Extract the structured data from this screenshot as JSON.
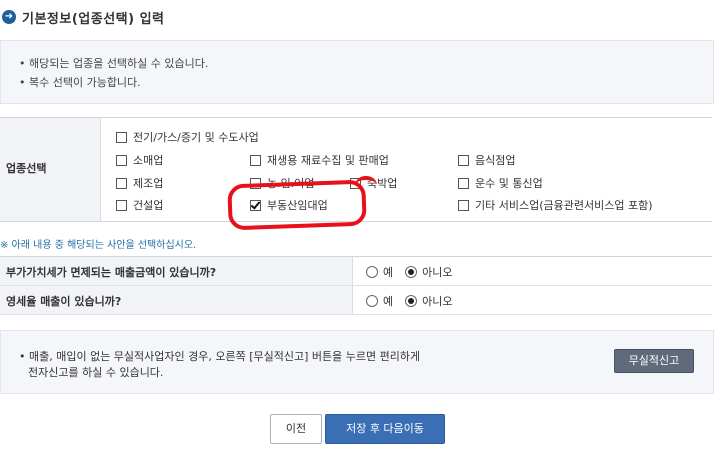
{
  "header": {
    "icon": "arrow-right-circle-icon",
    "title": "기본정보(업종선택) 입력"
  },
  "notice": [
    "• 해당되는 업종을 선택하실 수 있습니다.",
    "• 복수 선택이 가능합니다."
  ],
  "industry": {
    "label": "업종선택",
    "options": [
      {
        "label": "전기/가스/증기 및 수도사업",
        "checked": false
      },
      {
        "label": "소매업",
        "checked": false
      },
      {
        "label": "재생용 재료수집 및 판매업",
        "checked": false
      },
      {
        "label": "음식점업",
        "checked": false
      },
      {
        "label": "제조업",
        "checked": false
      },
      {
        "label": "농.임.어업",
        "checked": false
      },
      {
        "label": "숙박업",
        "checked": false
      },
      {
        "label": "운수 및 통신업",
        "checked": false
      },
      {
        "label": "건설업",
        "checked": false
      },
      {
        "label": "부동산임대업",
        "checked": true
      },
      {
        "label": "기타 서비스업(금융관련서비스업 포함)",
        "checked": false
      }
    ]
  },
  "hint": "※ 아래 내용 중 해당되는 사안을 선택하십시오.",
  "questions": [
    {
      "label": "부가가치세가 면제되는 매출금액이 있습니까?",
      "yes": "예",
      "no": "아니오",
      "selected": "no"
    },
    {
      "label": "영세율 매출이 있습니까?",
      "yes": "예",
      "no": "아니오",
      "selected": "no"
    }
  ],
  "bottom_notice": {
    "line1": "• 매출, 매입이 없는 무실적사업자인 경우, 오른쪽 [무실적신고] 버튼을 누르면 편리하게",
    "line2": "전자신고를 하실 수 있습니다.",
    "button": "무실적신고"
  },
  "buttons": {
    "prev": "이전",
    "next": "저장 후 다음이동"
  },
  "colors": {
    "accent": "#3a6fb5",
    "annotation": "#e8101a",
    "hint": "#1e6fa8"
  }
}
